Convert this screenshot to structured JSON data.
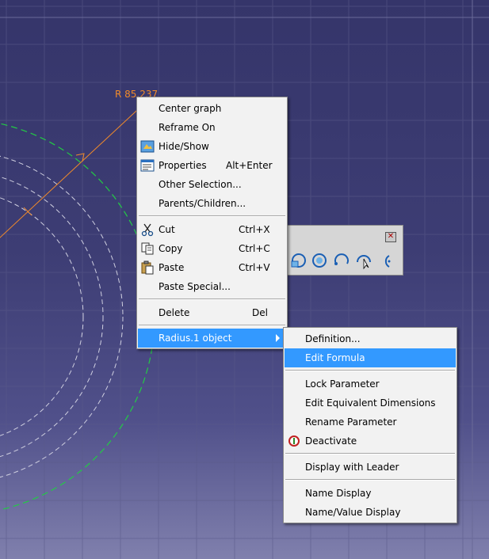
{
  "dimension_label": "R 85.237",
  "context_menu": {
    "items": [
      {
        "label": "Center graph",
        "shortcut": ""
      },
      {
        "label": "Reframe On",
        "shortcut": ""
      },
      {
        "label": "Hide/Show",
        "shortcut": "",
        "icon": "hide-show-icon"
      },
      {
        "label": "Properties",
        "shortcut": "Alt+Enter",
        "icon": "properties-icon"
      },
      {
        "label": "Other Selection...",
        "shortcut": ""
      },
      {
        "label": "Parents/Children...",
        "shortcut": ""
      },
      {
        "label": "Cut",
        "shortcut": "Ctrl+X",
        "icon": "scissors-icon"
      },
      {
        "label": "Copy",
        "shortcut": "Ctrl+C",
        "icon": "copy-icon"
      },
      {
        "label": "Paste",
        "shortcut": "Ctrl+V",
        "icon": "paste-icon"
      },
      {
        "label": "Paste Special...",
        "shortcut": ""
      },
      {
        "label": "Delete",
        "shortcut": "Del"
      },
      {
        "label": "Radius.1 object",
        "shortcut": "",
        "submenu": true
      }
    ]
  },
  "submenu": {
    "items": [
      {
        "label": "Definition..."
      },
      {
        "label": "Edit Formula",
        "highlighted": true
      },
      {
        "label": "Lock Parameter"
      },
      {
        "label": "Edit Equivalent Dimensions"
      },
      {
        "label": "Rename Parameter"
      },
      {
        "label": "Deactivate",
        "icon": "deactivate-icon"
      },
      {
        "label": "Display with Leader"
      },
      {
        "label": "Name Display"
      },
      {
        "label": "Name/Value Display"
      }
    ]
  },
  "toolbar": {
    "close_icon": "close-icon",
    "tools": [
      "circle-tool-icon",
      "circle-center-tool-icon",
      "arc-tool-icon",
      "three-point-arc-icon",
      "arc-limits-tool-icon"
    ]
  },
  "colors": {
    "background_top": "#35356a",
    "background_bottom": "#8080ad",
    "highlight": "#3399ff",
    "construction_arc": "#22cc44",
    "dimension": "#f08a2a"
  }
}
